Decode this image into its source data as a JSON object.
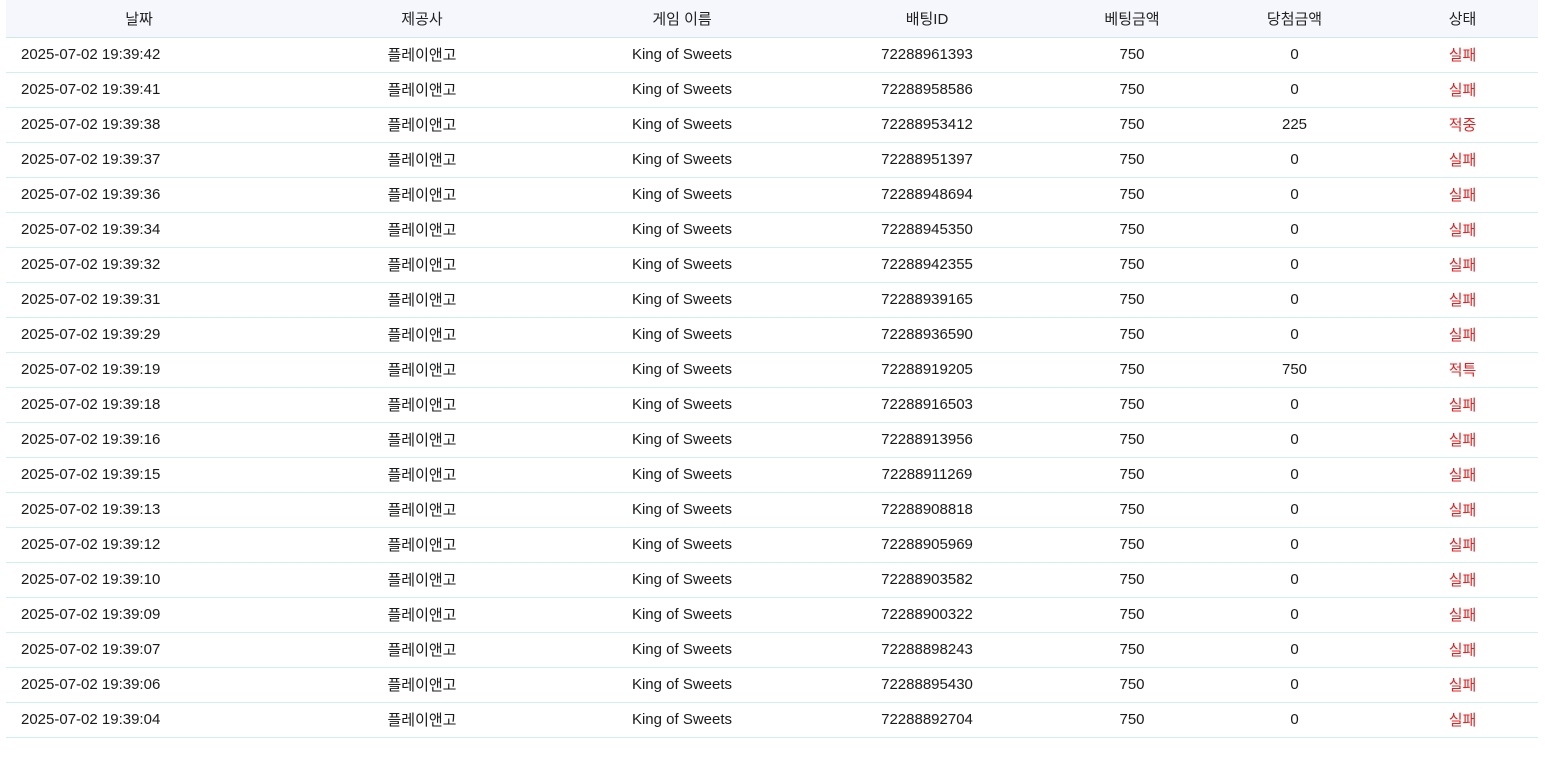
{
  "colors": {
    "status_text": "#e02222",
    "header_bg": "#f5f7fc",
    "row_divider": "#d3eeee"
  },
  "table": {
    "headers": [
      "날짜",
      "제공사",
      "게임 이름",
      "배팅ID",
      "베팅금액",
      "당첨금액",
      "상태"
    ],
    "rows": [
      [
        "2025-07-02 19:39:42",
        "플레이앤고",
        "King of Sweets",
        "72288961393",
        "750",
        "0",
        "실패"
      ],
      [
        "2025-07-02 19:39:41",
        "플레이앤고",
        "King of Sweets",
        "72288958586",
        "750",
        "0",
        "실패"
      ],
      [
        "2025-07-02 19:39:38",
        "플레이앤고",
        "King of Sweets",
        "72288953412",
        "750",
        "225",
        "적중"
      ],
      [
        "2025-07-02 19:39:37",
        "플레이앤고",
        "King of Sweets",
        "72288951397",
        "750",
        "0",
        "실패"
      ],
      [
        "2025-07-02 19:39:36",
        "플레이앤고",
        "King of Sweets",
        "72288948694",
        "750",
        "0",
        "실패"
      ],
      [
        "2025-07-02 19:39:34",
        "플레이앤고",
        "King of Sweets",
        "72288945350",
        "750",
        "0",
        "실패"
      ],
      [
        "2025-07-02 19:39:32",
        "플레이앤고",
        "King of Sweets",
        "72288942355",
        "750",
        "0",
        "실패"
      ],
      [
        "2025-07-02 19:39:31",
        "플레이앤고",
        "King of Sweets",
        "72288939165",
        "750",
        "0",
        "실패"
      ],
      [
        "2025-07-02 19:39:29",
        "플레이앤고",
        "King of Sweets",
        "72288936590",
        "750",
        "0",
        "실패"
      ],
      [
        "2025-07-02 19:39:19",
        "플레이앤고",
        "King of Sweets",
        "72288919205",
        "750",
        "750",
        "적특"
      ],
      [
        "2025-07-02 19:39:18",
        "플레이앤고",
        "King of Sweets",
        "72288916503",
        "750",
        "0",
        "실패"
      ],
      [
        "2025-07-02 19:39:16",
        "플레이앤고",
        "King of Sweets",
        "72288913956",
        "750",
        "0",
        "실패"
      ],
      [
        "2025-07-02 19:39:15",
        "플레이앤고",
        "King of Sweets",
        "72288911269",
        "750",
        "0",
        "실패"
      ],
      [
        "2025-07-02 19:39:13",
        "플레이앤고",
        "King of Sweets",
        "72288908818",
        "750",
        "0",
        "실패"
      ],
      [
        "2025-07-02 19:39:12",
        "플레이앤고",
        "King of Sweets",
        "72288905969",
        "750",
        "0",
        "실패"
      ],
      [
        "2025-07-02 19:39:10",
        "플레이앤고",
        "King of Sweets",
        "72288903582",
        "750",
        "0",
        "실패"
      ],
      [
        "2025-07-02 19:39:09",
        "플레이앤고",
        "King of Sweets",
        "72288900322",
        "750",
        "0",
        "실패"
      ],
      [
        "2025-07-02 19:39:07",
        "플레이앤고",
        "King of Sweets",
        "72288898243",
        "750",
        "0",
        "실패"
      ],
      [
        "2025-07-02 19:39:06",
        "플레이앤고",
        "King of Sweets",
        "72288895430",
        "750",
        "0",
        "실패"
      ],
      [
        "2025-07-02 19:39:04",
        "플레이앤고",
        "King of Sweets",
        "72288892704",
        "750",
        "0",
        "실패"
      ]
    ]
  }
}
